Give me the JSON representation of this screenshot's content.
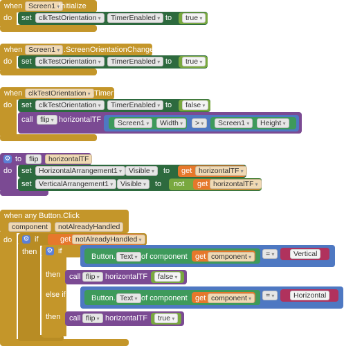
{
  "blocks": {
    "init": {
      "when": "when",
      "component": "Screen1",
      "event": ".Initialize",
      "do": "do",
      "set": "set",
      "timer": "clkTestOrientation",
      "prop": "TimerEnabled",
      "to": "to",
      "value": "true"
    },
    "orient": {
      "when": "when",
      "component": "Screen1",
      "event": ".ScreenOrientationChanged",
      "do": "do",
      "set": "set",
      "timer": "clkTestOrientation",
      "prop": "TimerEnabled",
      "to": "to",
      "value": "true"
    },
    "timer": {
      "when": "when",
      "component": "clkTestOrientation",
      "event": ".Timer",
      "do": "do",
      "set": "set",
      "timerc": "clkTestOrientation",
      "prop": "TimerEnabled",
      "to": "to",
      "value": "false",
      "call": "call",
      "proc": "flip",
      "param": "horizontalTF",
      "screen_a": "Screen1",
      "width": "Width",
      "op": ">",
      "screen_b": "Screen1",
      "height": "Height"
    },
    "flipdef": {
      "to": "to",
      "name": "flip",
      "param": "horizontalTF",
      "do": "do",
      "set1": "set",
      "comp1": "HorizontalArrangement1",
      "vis1": "Visible",
      "to1": "to",
      "get1": "get",
      "var1": "horizontalTF",
      "set2": "set",
      "comp2": "VerticalArrangement1",
      "vis2": "Visible",
      "to2": "to",
      "not": "not",
      "get2": "get",
      "var2": "horizontalTF"
    },
    "click": {
      "when": "when any Button.Click",
      "p1": "component",
      "p2": "notAlreadyHandled",
      "do": "do",
      "if": "if",
      "get": "get",
      "var": "notAlreadyHandled",
      "then": "then",
      "if2": "if",
      "btn1": "Button.",
      "text1": "Text",
      "ofc1": "of component",
      "get1": "get",
      "comp1": "component",
      "eq1": "=",
      "str1": "Vertical",
      "then1": "then",
      "call1": "call",
      "proc1": "flip",
      "param1": "horizontalTF",
      "bool1": "false",
      "elseif": "else if",
      "btn2": "Button.",
      "text2": "Text",
      "ofc2": "of component",
      "get2": "get",
      "comp2": "component",
      "eq2": "=",
      "str2": "Horizontal",
      "then2": "then",
      "call2": "call",
      "proc2": "flip",
      "param2": "horizontalTF",
      "bool2": "true"
    }
  },
  "colors": {
    "control": "#c4962a",
    "set": "#2d6a3e",
    "procedure": "#7b4a93",
    "logic": "#79a83f",
    "variable": "#e6782b",
    "compare": "#4e78c2",
    "text": "#b0325d"
  }
}
